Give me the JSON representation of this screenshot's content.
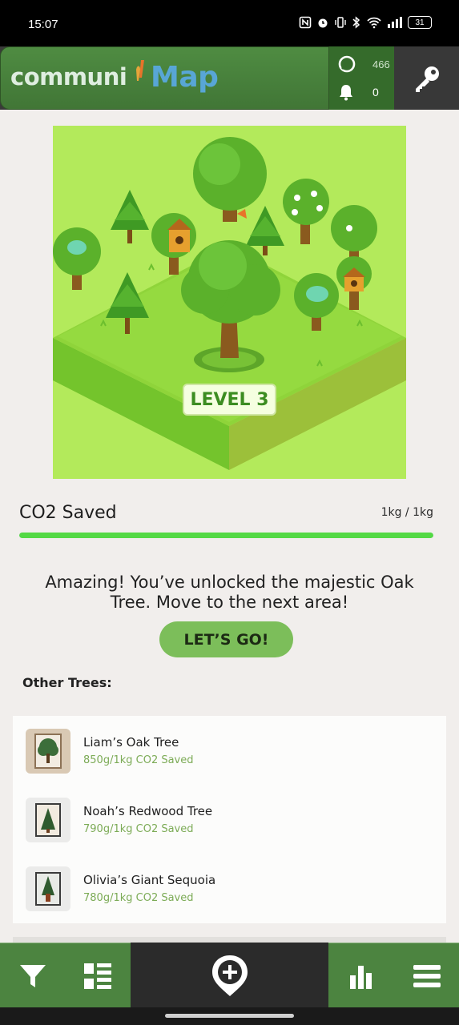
{
  "status_bar": {
    "time": "15:07",
    "battery": "31",
    "icons": [
      "nfc-icon",
      "alarm-icon",
      "vibrate-icon",
      "bluetooth-icon",
      "wifi-icon",
      "signal-icon",
      "battery-icon"
    ]
  },
  "header": {
    "logo_part1": "communi",
    "logo_part2": "Map",
    "points_value": "466",
    "notifications_value": "0",
    "icons": [
      "points-icon",
      "bell-icon",
      "key-icon"
    ]
  },
  "hero": {
    "level_label": "LEVEL 3"
  },
  "progress": {
    "title": "CO2 Saved",
    "amount": "1kg / 1kg",
    "fraction": 1.0
  },
  "message": {
    "text": "Amazing! You’ve unlocked the majestic Oak Tree. Move to the next area!",
    "button_label": "LET’S GO!"
  },
  "other_trees": {
    "title": "Other Trees:",
    "items": [
      {
        "name": "Liam’s Oak Tree",
        "sub": "850g/1kg CO2 Saved",
        "icon": "oak-tree-icon"
      },
      {
        "name": "Noah’s Redwood Tree",
        "sub": "790g/1kg CO2 Saved",
        "icon": "redwood-tree-icon"
      },
      {
        "name": "Olivia’s Giant Sequoia",
        "sub": "780g/1kg CO2 Saved",
        "icon": "sequoia-tree-icon"
      }
    ]
  },
  "bottom_nav": {
    "icons": [
      "filter-icon",
      "list-view-icon",
      "add-location-icon",
      "stats-icon",
      "menu-icon"
    ]
  },
  "colors": {
    "header_green": "#4f8c42",
    "accent_green": "#7cbe5a",
    "progress_green": "#53d944",
    "map_blue": "#58a6d6"
  }
}
